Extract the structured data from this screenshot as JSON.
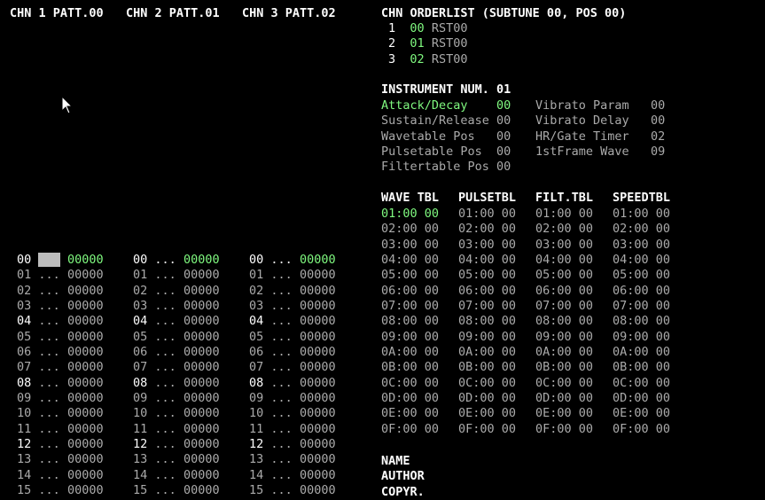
{
  "colors": {
    "background": "#000000",
    "text_white": "#ffffff",
    "text_gray": "#aaaaaa",
    "text_green": "#7ff87f",
    "cursor": "#bdbdbd"
  },
  "channels": [
    {
      "header": "CHN 1 PATT.00",
      "rows": [
        {
          "num": "00",
          "note": "...",
          "data": "00000"
        },
        {
          "num": "01",
          "note": "...",
          "data": "00000"
        },
        {
          "num": "02",
          "note": "...",
          "data": "00000"
        },
        {
          "num": "03",
          "note": "...",
          "data": "00000"
        },
        {
          "num": "04",
          "note": "...",
          "data": "00000"
        },
        {
          "num": "05",
          "note": "...",
          "data": "00000"
        },
        {
          "num": "06",
          "note": "...",
          "data": "00000"
        },
        {
          "num": "07",
          "note": "...",
          "data": "00000"
        },
        {
          "num": "08",
          "note": "...",
          "data": "00000"
        },
        {
          "num": "09",
          "note": "...",
          "data": "00000"
        },
        {
          "num": "10",
          "note": "...",
          "data": "00000"
        },
        {
          "num": "11",
          "note": "...",
          "data": "00000"
        },
        {
          "num": "12",
          "note": "...",
          "data": "00000"
        },
        {
          "num": "13",
          "note": "...",
          "data": "00000"
        },
        {
          "num": "14",
          "note": "...",
          "data": "00000"
        },
        {
          "num": "15",
          "note": "...",
          "data": "00000"
        }
      ]
    },
    {
      "header": "CHN 2 PATT.01",
      "rows": [
        {
          "num": "00",
          "note": "...",
          "data": "00000"
        },
        {
          "num": "01",
          "note": "...",
          "data": "00000"
        },
        {
          "num": "02",
          "note": "...",
          "data": "00000"
        },
        {
          "num": "03",
          "note": "...",
          "data": "00000"
        },
        {
          "num": "04",
          "note": "...",
          "data": "00000"
        },
        {
          "num": "05",
          "note": "...",
          "data": "00000"
        },
        {
          "num": "06",
          "note": "...",
          "data": "00000"
        },
        {
          "num": "07",
          "note": "...",
          "data": "00000"
        },
        {
          "num": "08",
          "note": "...",
          "data": "00000"
        },
        {
          "num": "09",
          "note": "...",
          "data": "00000"
        },
        {
          "num": "10",
          "note": "...",
          "data": "00000"
        },
        {
          "num": "11",
          "note": "...",
          "data": "00000"
        },
        {
          "num": "12",
          "note": "...",
          "data": "00000"
        },
        {
          "num": "13",
          "note": "...",
          "data": "00000"
        },
        {
          "num": "14",
          "note": "...",
          "data": "00000"
        },
        {
          "num": "15",
          "note": "...",
          "data": "00000"
        }
      ]
    },
    {
      "header": "CHN 3 PATT.02",
      "rows": [
        {
          "num": "00",
          "note": "...",
          "data": "00000"
        },
        {
          "num": "01",
          "note": "...",
          "data": "00000"
        },
        {
          "num": "02",
          "note": "...",
          "data": "00000"
        },
        {
          "num": "03",
          "note": "...",
          "data": "00000"
        },
        {
          "num": "04",
          "note": "...",
          "data": "00000"
        },
        {
          "num": "05",
          "note": "...",
          "data": "00000"
        },
        {
          "num": "06",
          "note": "...",
          "data": "00000"
        },
        {
          "num": "07",
          "note": "...",
          "data": "00000"
        },
        {
          "num": "08",
          "note": "...",
          "data": "00000"
        },
        {
          "num": "09",
          "note": "...",
          "data": "00000"
        },
        {
          "num": "10",
          "note": "...",
          "data": "00000"
        },
        {
          "num": "11",
          "note": "...",
          "data": "00000"
        },
        {
          "num": "12",
          "note": "...",
          "data": "00000"
        },
        {
          "num": "13",
          "note": "...",
          "data": "00000"
        },
        {
          "num": "14",
          "note": "...",
          "data": "00000"
        },
        {
          "num": "15",
          "note": "...",
          "data": "00000"
        }
      ]
    }
  ],
  "orderlist": {
    "title": "CHN ORDERLIST (SUBTUNE 00, POS 00)",
    "rows": [
      {
        "index": "1",
        "pattern": "00",
        "cmd": "RST00"
      },
      {
        "index": "2",
        "pattern": "01",
        "cmd": "RST00"
      },
      {
        "index": "3",
        "pattern": "02",
        "cmd": "RST00"
      }
    ]
  },
  "instrument": {
    "title": "INSTRUMENT NUM. 01",
    "params_left": [
      {
        "label": "Attack/Decay",
        "value": "00"
      },
      {
        "label": "Sustain/Release",
        "value": "00"
      },
      {
        "label": "Wavetable Pos",
        "value": "00"
      },
      {
        "label": "Pulsetable Pos",
        "value": "00"
      },
      {
        "label": "Filtertable Pos",
        "value": "00"
      }
    ],
    "params_right": [
      {
        "label": "Vibrato Param",
        "value": "00"
      },
      {
        "label": "Vibrato Delay",
        "value": "00"
      },
      {
        "label": "HR/Gate Timer",
        "value": "02"
      },
      {
        "label": "1stFrame Wave",
        "value": "09"
      }
    ]
  },
  "tables": {
    "headers": [
      "WAVE TBL",
      "PULSETBL",
      "FILT.TBL",
      "SPEEDTBL"
    ],
    "rows": [
      "01:00 00",
      "02:00 00",
      "03:00 00",
      "04:00 00",
      "05:00 00",
      "06:00 00",
      "07:00 00",
      "08:00 00",
      "09:00 00",
      "0A:00 00",
      "0B:00 00",
      "0C:00 00",
      "0D:00 00",
      "0E:00 00",
      "0F:00 00"
    ]
  },
  "song_info": {
    "labels": [
      "NAME",
      "AUTHOR",
      "COPYR."
    ]
  }
}
